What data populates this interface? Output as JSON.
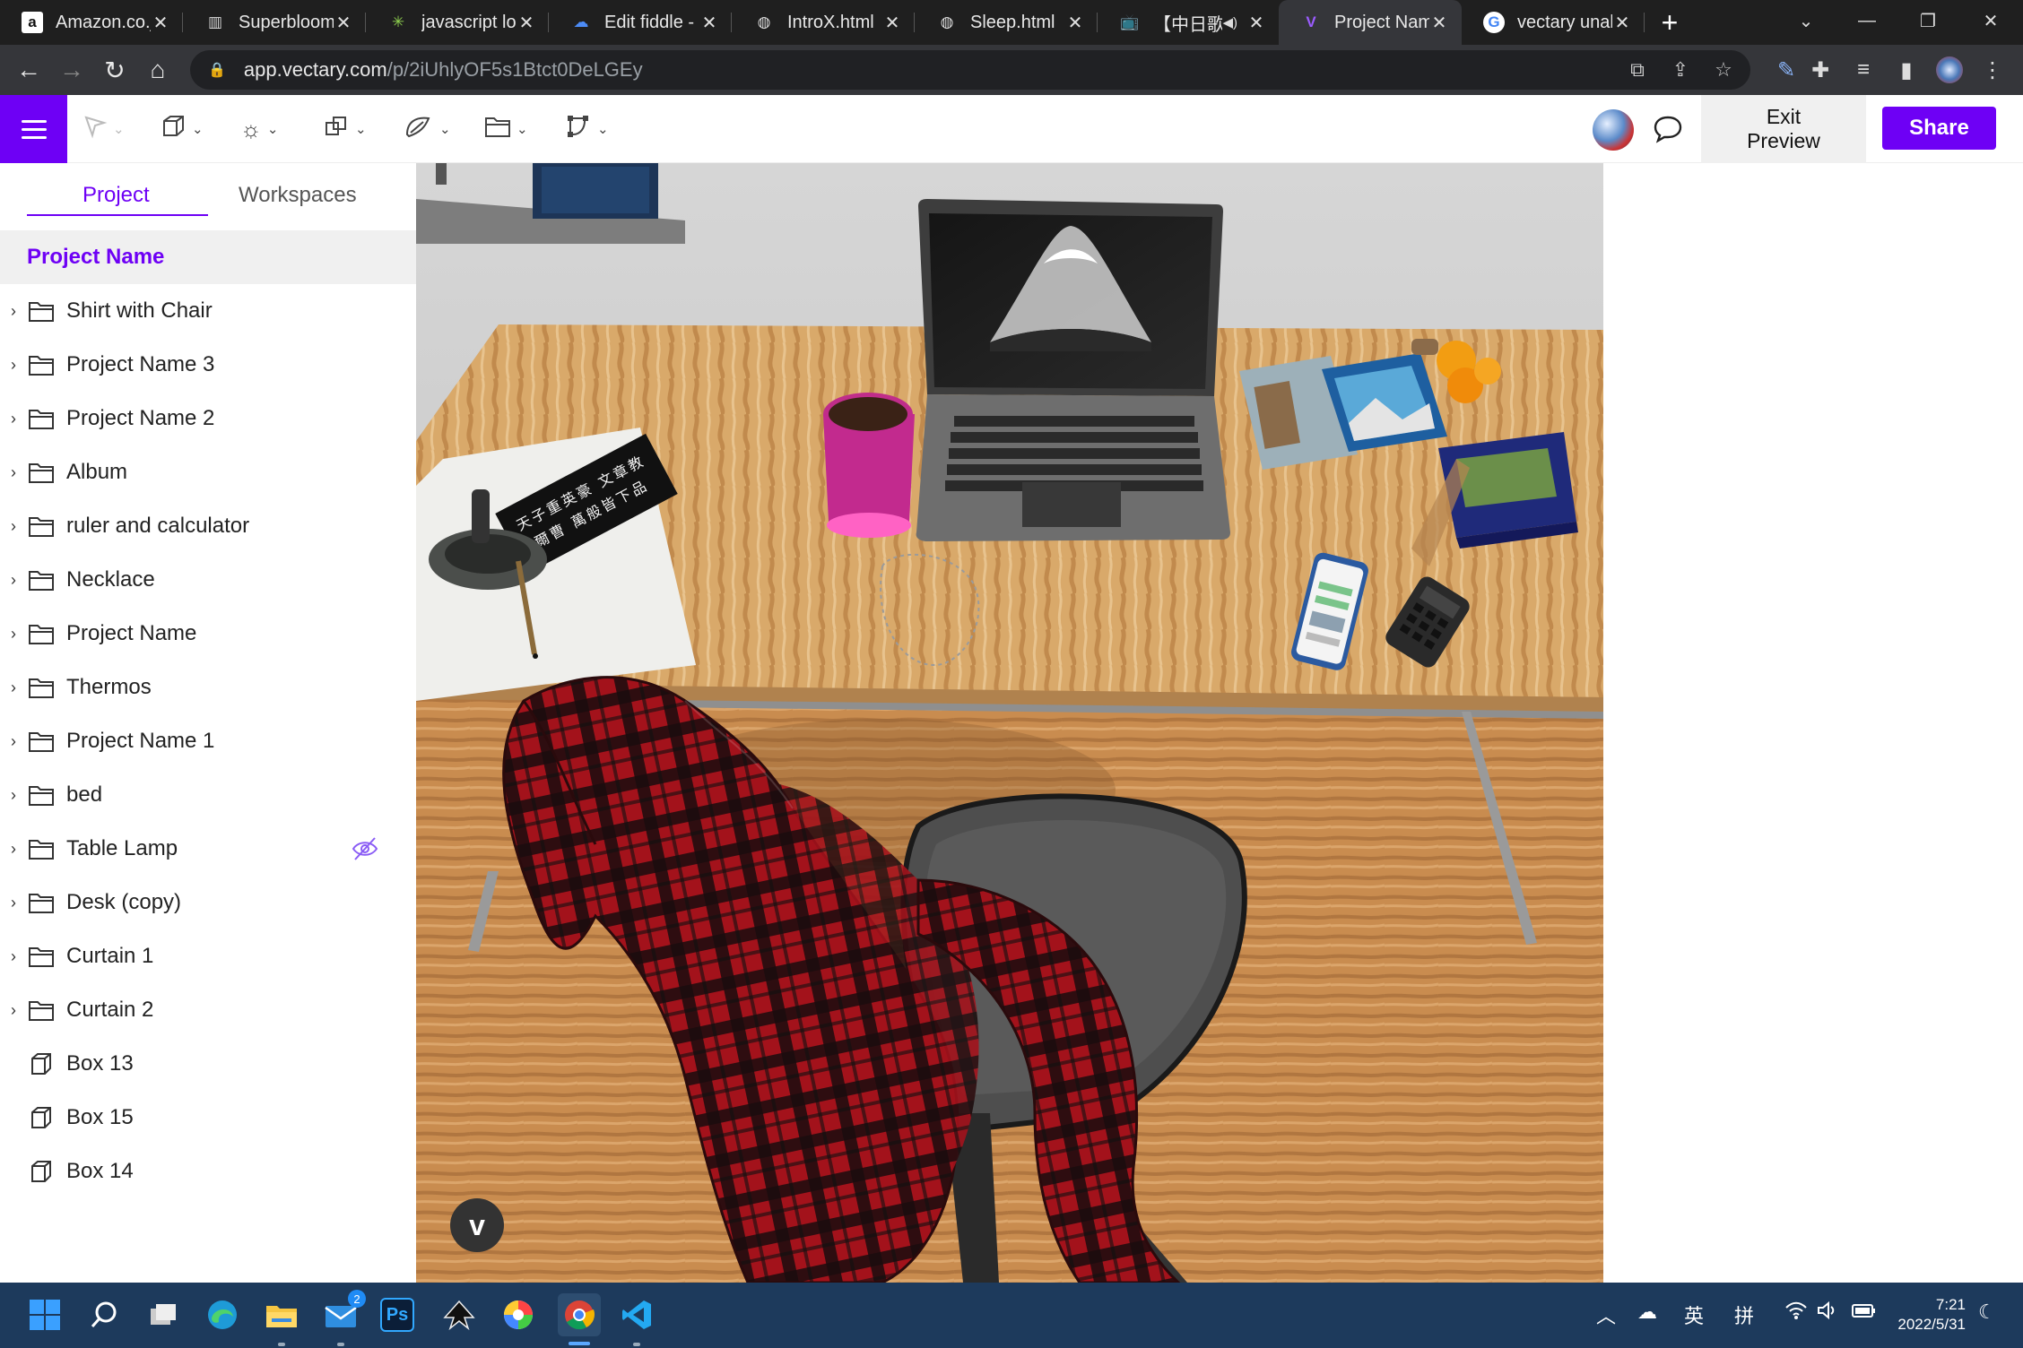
{
  "browser": {
    "tabs": [
      {
        "title": "Amazon.co.jp",
        "icon": "amazon-icon"
      },
      {
        "title": "Superbloom",
        "icon": "superbloom-icon"
      },
      {
        "title": "javascript lo",
        "icon": "sparkle-icon"
      },
      {
        "title": "Edit fiddle -",
        "icon": "jsfiddle-icon"
      },
      {
        "title": "IntroX.html",
        "icon": "globe-icon"
      },
      {
        "title": "Sleep.html",
        "icon": "globe-icon"
      },
      {
        "title": "【中日歌",
        "icon": "bilibili-icon"
      },
      {
        "title": "Project Nam",
        "icon": "vectary-icon"
      },
      {
        "title": "vectary unal",
        "icon": "google-icon"
      }
    ],
    "new_tab": "+",
    "address": {
      "domain": "app.vectary.com",
      "path": "/p/2iUhlyOF5s1Btct0DeLGEy"
    }
  },
  "app": {
    "exit_preview": "Exit\nPreview",
    "share": "Share",
    "accent": "#6e00f5"
  },
  "sidebar": {
    "tabs": [
      "Project",
      "Workspaces"
    ],
    "project_name": "Project Name",
    "items": [
      {
        "label": "Shirt with Chair",
        "type": "folder"
      },
      {
        "label": "Project Name 3",
        "type": "folder"
      },
      {
        "label": "Project Name 2",
        "type": "folder"
      },
      {
        "label": "Album",
        "type": "folder"
      },
      {
        "label": "ruler and calculator",
        "type": "folder"
      },
      {
        "label": "Necklace",
        "type": "folder"
      },
      {
        "label": "Project Name",
        "type": "folder"
      },
      {
        "label": "Thermos",
        "type": "folder"
      },
      {
        "label": "Project Name 1",
        "type": "folder"
      },
      {
        "label": "bed",
        "type": "folder"
      },
      {
        "label": "Table Lamp",
        "type": "folder",
        "hidden": true
      },
      {
        "label": "Desk (copy)",
        "type": "folder"
      },
      {
        "label": "Curtain 1",
        "type": "folder"
      },
      {
        "label": "Curtain 2",
        "type": "folder"
      },
      {
        "label": "Box 13",
        "type": "box"
      },
      {
        "label": "Box 15",
        "type": "box"
      },
      {
        "label": "Box 14",
        "type": "box"
      }
    ]
  },
  "scene": {
    "calligraphy": "天子重英豪 文章教爾曹 萬般皆下品 惟有讀書高"
  },
  "taskbar": {
    "ime_lang": "英",
    "ime_mode": "拼",
    "time": "7:21",
    "date": "2022/5/31",
    "mail_badge": "2"
  }
}
